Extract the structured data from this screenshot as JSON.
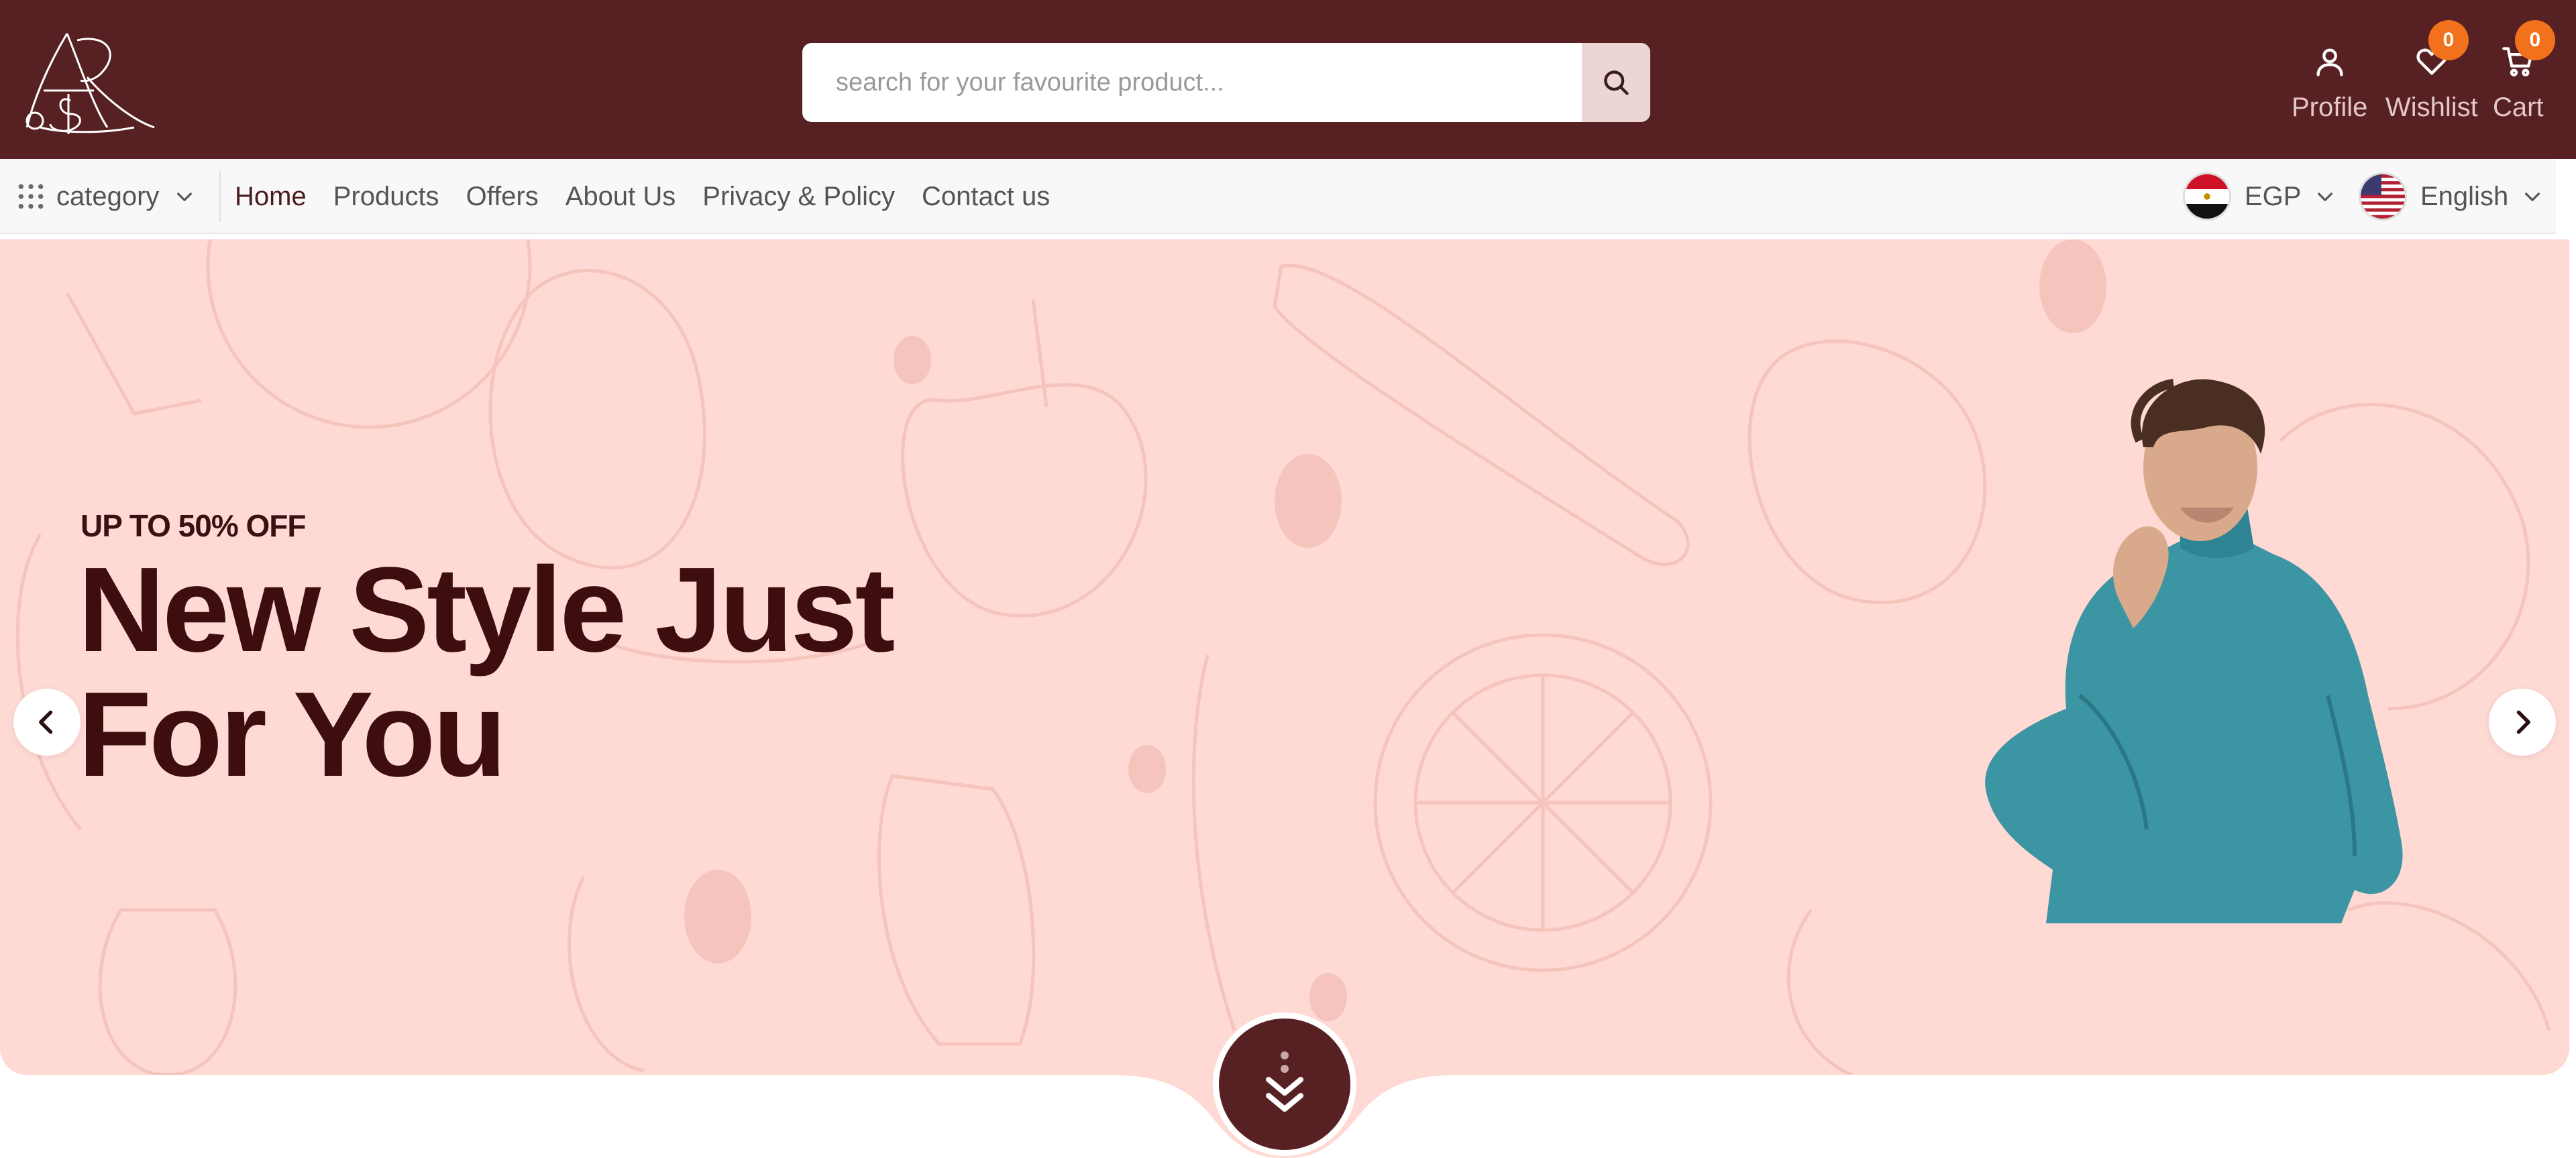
{
  "header": {
    "logo_text": "ASR",
    "search": {
      "placeholder": "search for your favourite product..."
    },
    "actions": [
      {
        "id": "profile",
        "label": "Profile",
        "icon": "user-icon"
      },
      {
        "id": "wishlist",
        "label": "Wishlist",
        "icon": "heart-icon",
        "count": "0"
      },
      {
        "id": "cart",
        "label": "Cart",
        "icon": "cart-icon",
        "count": "0"
      }
    ]
  },
  "nav": {
    "category_label": "category",
    "links": [
      "Home",
      "Products",
      "Offers",
      "About Us",
      "Privacy & Policy",
      "Contact us"
    ],
    "active": "Home",
    "currency": "EGP",
    "language": "English"
  },
  "hero": {
    "tag": "UP TO 50% OFF",
    "title_line1": "New Style Just",
    "title_line2": "For You"
  },
  "colors": {
    "header_bg": "#572123",
    "hero_bg": "#ffd9d3",
    "title": "#3d0d10",
    "badge": "#f2711c",
    "model_sweater": "#3c95a3"
  }
}
